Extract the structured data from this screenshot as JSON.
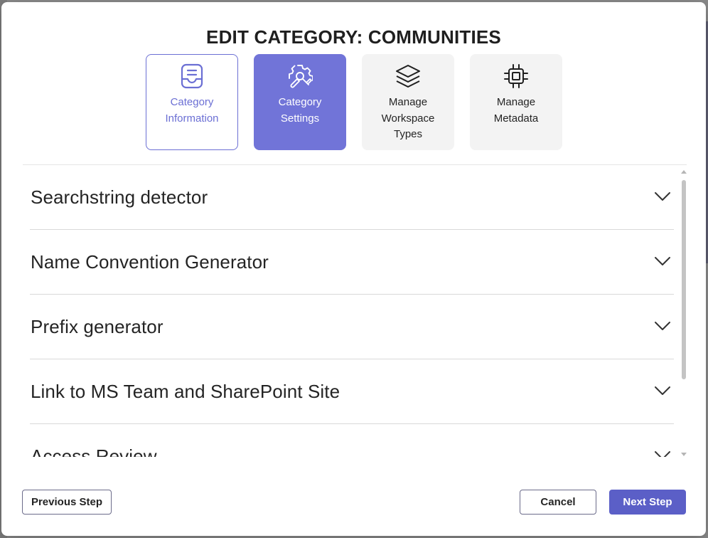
{
  "dialog": {
    "title": "EDIT CATEGORY: COMMUNITIES"
  },
  "steps": [
    {
      "label": "Category Information",
      "icon": "inbox-icon",
      "state": "outlined"
    },
    {
      "label": "Category Settings",
      "icon": "settings-tools-icon",
      "state": "active"
    },
    {
      "label": "Manage Workspace Types",
      "icon": "layers-icon",
      "state": "default"
    },
    {
      "label": "Manage Metadata",
      "icon": "chip-icon",
      "state": "default"
    }
  ],
  "accordion": [
    {
      "title": "Searchstring detector"
    },
    {
      "title": "Name Convention Generator"
    },
    {
      "title": "Prefix generator"
    },
    {
      "title": "Link to MS Team and SharePoint Site"
    },
    {
      "title": "Access Review"
    }
  ],
  "footer": {
    "previous_label": "Previous Step",
    "cancel_label": "Cancel",
    "next_label": "Next Step"
  },
  "colors": {
    "accent": "#5b5fc7",
    "active_step": "#7174d8",
    "step_bg": "#f3f3f3"
  }
}
